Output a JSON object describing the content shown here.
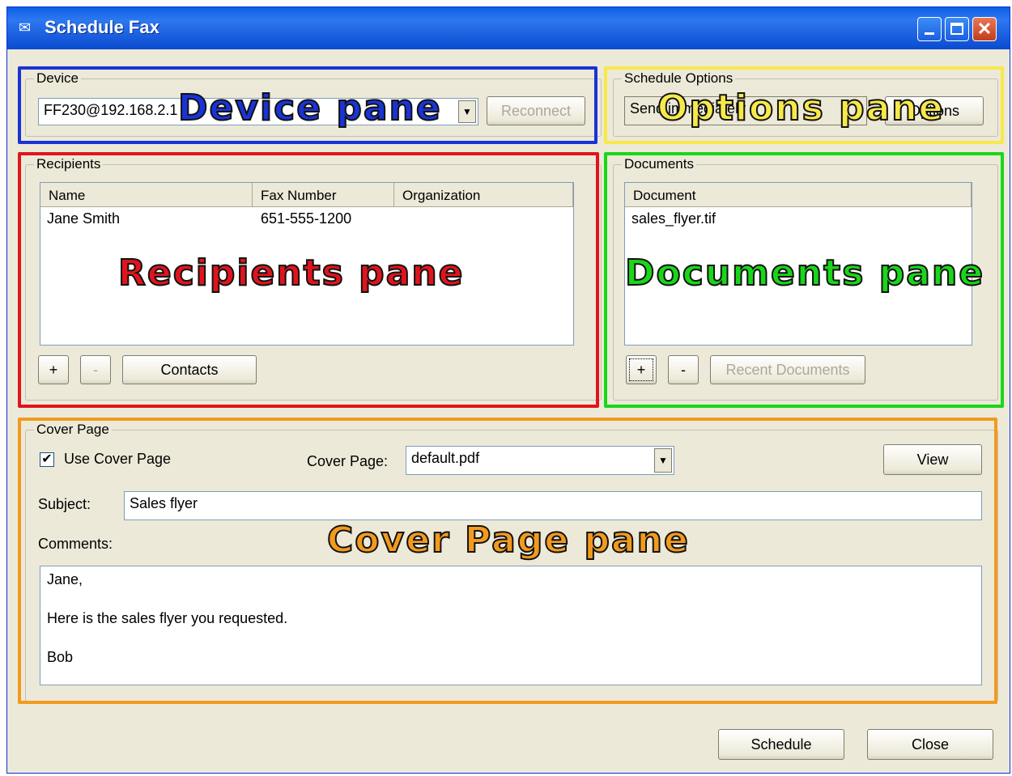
{
  "window": {
    "title": "Schedule Fax"
  },
  "device": {
    "group_label": "Device",
    "selected": "FF230@192.168.2.1",
    "reconnect_label": "Reconnect"
  },
  "options": {
    "group_label": "Schedule Options",
    "send_value": "Send immediately",
    "options_label": "Options"
  },
  "recipients": {
    "group_label": "Recipients",
    "columns": [
      "Name",
      "Fax Number",
      "Organization"
    ],
    "rows": [
      {
        "name": "Jane Smith",
        "fax": "651-555-1200",
        "org": ""
      }
    ],
    "add_label": "+",
    "remove_label": "-",
    "contacts_label": "Contacts"
  },
  "documents": {
    "group_label": "Documents",
    "column": "Document",
    "rows": [
      "sales_flyer.tif"
    ],
    "add_label": "+",
    "remove_label": "-",
    "recent_label": "Recent Documents"
  },
  "cover": {
    "group_label": "Cover Page",
    "use_label": "Use Cover Page",
    "use_checked": true,
    "cover_label": "Cover Page:",
    "cover_value": "default.pdf",
    "view_label": "View",
    "subject_label": "Subject:",
    "subject_value": "Sales flyer",
    "comments_label": "Comments:",
    "comments_lines": [
      "Jane,",
      "Here is the sales flyer you requested.",
      "Bob"
    ]
  },
  "footer": {
    "schedule_label": "Schedule",
    "close_label": "Close"
  },
  "annotations": {
    "device": "Device pane",
    "options": "Options pane",
    "recipients": "Recipients pane",
    "documents": "Documents pane",
    "cover": "Cover Page pane",
    "colors": {
      "device": "#1a33d6",
      "options": "#f7e94a",
      "recipients": "#e0141c",
      "documents": "#19d619",
      "cover": "#f29a1e"
    }
  }
}
